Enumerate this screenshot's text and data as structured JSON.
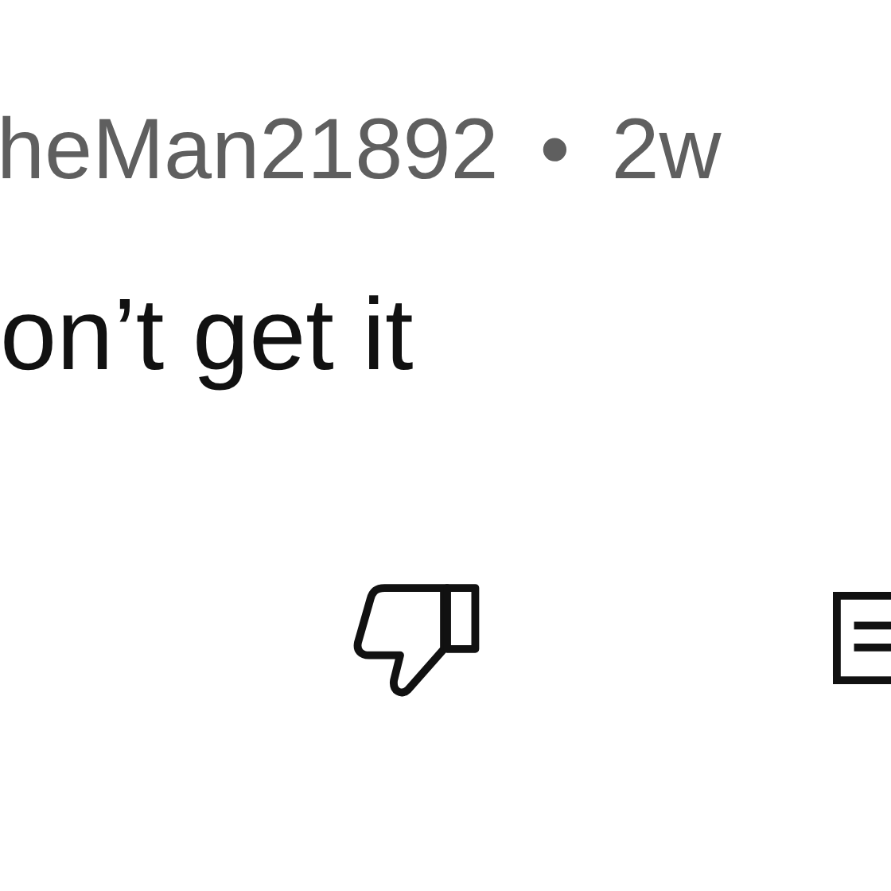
{
  "comment": {
    "author": "heMan21892",
    "separator": "•",
    "age": "2w",
    "text": "on’t get it"
  },
  "actions": [
    {
      "kind": "dislike"
    },
    {
      "kind": "reply"
    }
  ]
}
